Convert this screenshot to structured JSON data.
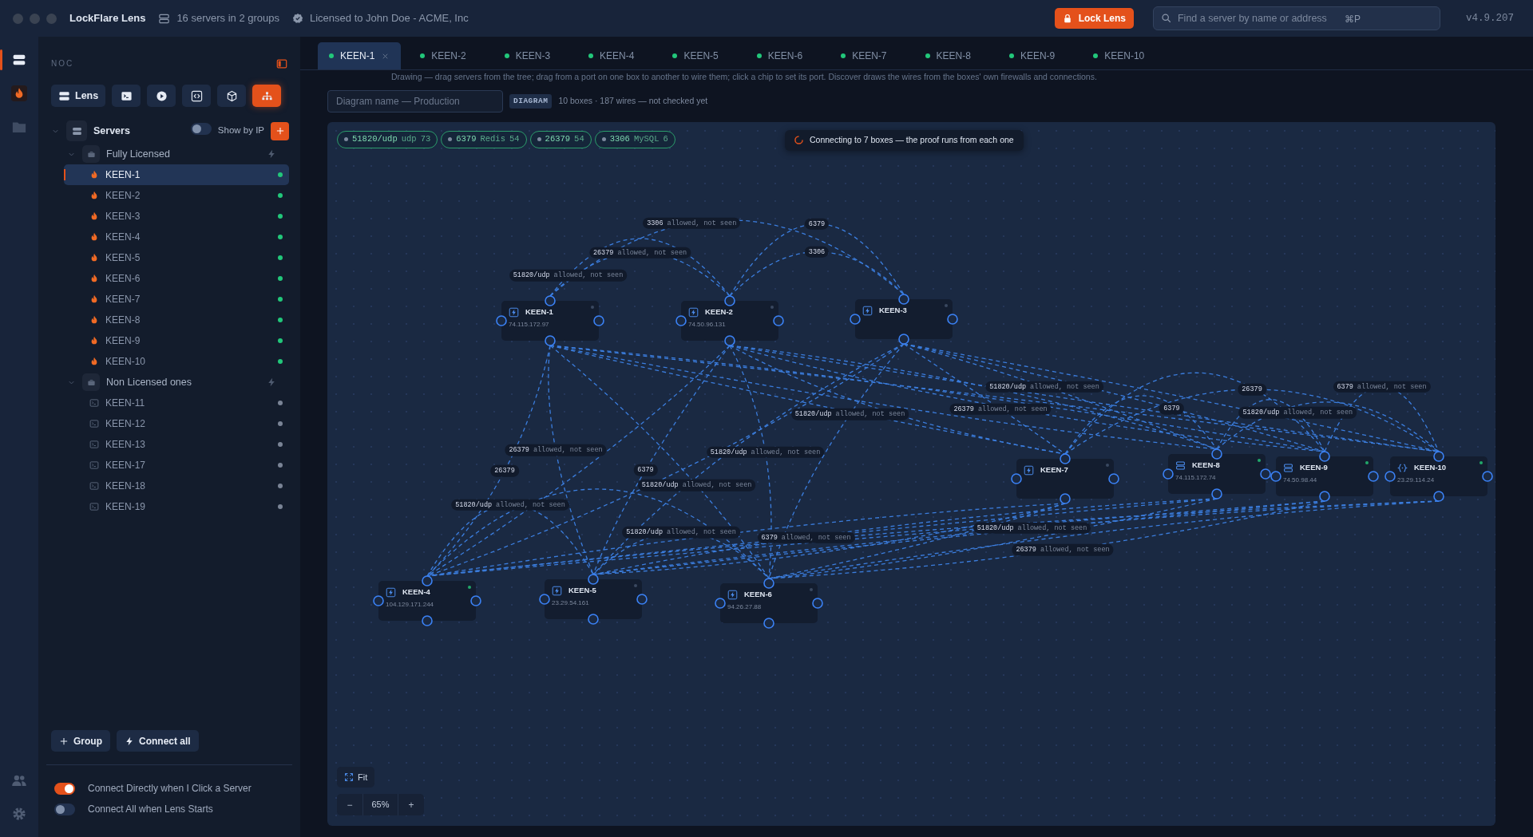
{
  "app": {
    "title": "LockFlare Lens",
    "server_summary": "16 servers in 2 groups",
    "license": "Licensed to John Doe - ACME, Inc",
    "lock_button": "Lock Lens",
    "search": {
      "placeholder": "Find a server by name or address",
      "shortcut": "⌘P"
    },
    "version": "v4.9.207"
  },
  "rail": {
    "top": [
      {
        "kind": "servers",
        "selected": true
      },
      {
        "kind": "app",
        "selected": false
      },
      {
        "kind": "folder",
        "selected": false
      }
    ],
    "bottom": [
      {
        "kind": "users",
        "selected": false
      },
      {
        "kind": "settings",
        "selected": false
      }
    ]
  },
  "sidebar": {
    "heading": "NOC",
    "tools": [
      {
        "kind": "servers",
        "label": "Lens",
        "selected": false
      },
      {
        "kind": "terminal",
        "selected": false
      },
      {
        "kind": "play",
        "selected": false
      },
      {
        "kind": "code",
        "selected": false
      },
      {
        "kind": "cube",
        "selected": false
      },
      {
        "kind": "sitemap",
        "selected": true
      }
    ],
    "tree": {
      "label": "Servers",
      "expanded": true,
      "show_by_ip": {
        "label": "Show by IP",
        "on": false
      },
      "groups": [
        {
          "label": "Fully Licensed",
          "expanded": true,
          "children": [
            {
              "label": "KEEN-1",
              "kind": "flame",
              "selected": true,
              "online": true
            },
            {
              "label": "KEEN-2",
              "kind": "flame",
              "selected": false,
              "online": true
            },
            {
              "label": "KEEN-3",
              "kind": "flame",
              "selected": false,
              "online": true
            },
            {
              "label": "KEEN-4",
              "kind": "flame",
              "selected": false,
              "online": true
            },
            {
              "label": "KEEN-5",
              "kind": "flame",
              "selected": false,
              "online": true
            },
            {
              "label": "KEEN-6",
              "kind": "flame",
              "selected": false,
              "online": true
            },
            {
              "label": "KEEN-7",
              "kind": "flame",
              "selected": false,
              "online": true
            },
            {
              "label": "KEEN-8",
              "kind": "flame",
              "selected": false,
              "online": true
            },
            {
              "label": "KEEN-9",
              "kind": "flame",
              "selected": false,
              "online": true
            },
            {
              "label": "KEEN-10",
              "kind": "flame",
              "selected": false,
              "online": true
            }
          ]
        },
        {
          "label": "Non Licensed ones",
          "expanded": true,
          "children": [
            {
              "label": "KEEN-11",
              "kind": "terminal",
              "selected": false,
              "online": false
            },
            {
              "label": "KEEN-12",
              "kind": "terminal",
              "selected": false,
              "online": false
            },
            {
              "label": "KEEN-13",
              "kind": "terminal",
              "selected": false,
              "online": false
            },
            {
              "label": "KEEN-17",
              "kind": "terminal",
              "selected": false,
              "online": false
            },
            {
              "label": "KEEN-18",
              "kind": "terminal",
              "selected": false,
              "online": false
            },
            {
              "label": "KEEN-19",
              "kind": "terminal",
              "selected": false,
              "online": false
            }
          ]
        }
      ]
    },
    "actions": [
      {
        "kind": "plus",
        "label": "Group"
      },
      {
        "kind": "bolt",
        "label": "Connect all"
      }
    ],
    "settings": [
      {
        "label": "Connect Directly when I Click a Server",
        "on": true
      },
      {
        "label": "Connect All when Lens Starts",
        "on": false
      }
    ]
  },
  "tabs": [
    {
      "label": "KEEN-1",
      "selected": true,
      "online": true
    },
    {
      "label": "KEEN-2",
      "selected": false,
      "online": true
    },
    {
      "label": "KEEN-3",
      "selected": false,
      "online": true
    },
    {
      "label": "KEEN-4",
      "selected": false,
      "online": true
    },
    {
      "label": "KEEN-5",
      "selected": false,
      "online": true
    },
    {
      "label": "KEEN-6",
      "selected": false,
      "online": true
    },
    {
      "label": "KEEN-7",
      "selected": false,
      "online": true
    },
    {
      "label": "KEEN-8",
      "selected": false,
      "online": true
    },
    {
      "label": "KEEN-9",
      "selected": false,
      "online": true
    },
    {
      "label": "KEEN-10",
      "selected": false,
      "online": true
    }
  ],
  "diagram": {
    "hint": "Drawing — drag servers from the tree; drag from a port on one box to another to wire them; click a chip to set its port. Discover draws the wires from the boxes' own firewalls and connections.",
    "name_field": {
      "placeholder": "Diagram name — Production"
    },
    "badge": "DIAGRAM",
    "summary": "10 boxes · 187 wires — not checked yet",
    "chips": [
      {
        "port": "51820/udp",
        "service": "udp",
        "count": "73"
      },
      {
        "port": "6379",
        "service": "Redis",
        "count": "54"
      },
      {
        "port": "26379",
        "count": "54"
      },
      {
        "port": "3306",
        "service": "MySQL",
        "count": "6"
      }
    ],
    "status": "Connecting to 7 boxes — the proof runs from each one",
    "nodes": [
      {
        "name": "KEEN-1",
        "address": "74.115.172.97",
        "kind": "bolt",
        "online": false
      },
      {
        "name": "KEEN-2",
        "address": "74.50.96.131",
        "kind": "bolt",
        "online": false
      },
      {
        "name": "KEEN-3",
        "kind": "bolt",
        "online": false
      },
      {
        "name": "KEEN-4",
        "address": "104.129.171.244",
        "kind": "bolt",
        "online": true
      },
      {
        "name": "KEEN-5",
        "address": "23.29.54.161",
        "kind": "bolt",
        "online": false
      },
      {
        "name": "KEEN-6",
        "address": "94.26.27.88",
        "kind": "bolt",
        "online": false
      },
      {
        "name": "KEEN-7",
        "kind": "bolt",
        "online": false
      },
      {
        "name": "KEEN-8",
        "address": "74.115.172.74",
        "kind": "server",
        "online": true
      },
      {
        "name": "KEEN-9",
        "address": "74.50.98.44",
        "kind": "server",
        "online": true
      },
      {
        "name": "KEEN-10",
        "address": "23.29.114.24",
        "kind": "braces",
        "online": true
      }
    ],
    "wire_labels": [
      {
        "port": "3306",
        "note": "allowed, not seen"
      },
      {
        "port": "6379"
      },
      {
        "port": "26379",
        "note": "allowed, not seen"
      },
      {
        "port": "3306"
      },
      {
        "port": "51820/udp",
        "note": "allowed, not seen"
      },
      {
        "port": "51820/udp",
        "note": "allowed, not seen"
      },
      {
        "port": "26379"
      },
      {
        "port": "6379",
        "note": "allowed, not seen"
      },
      {
        "port": "51820/udp",
        "note": "allowed, not seen"
      },
      {
        "port": "26379",
        "note": "allowed, not seen"
      },
      {
        "port": "6379"
      },
      {
        "port": "51820/udp",
        "note": "allowed, not seen"
      },
      {
        "port": "26379",
        "note": "allowed, not seen"
      },
      {
        "port": "51820/udp",
        "note": "allowed, not seen"
      },
      {
        "port": "26379"
      },
      {
        "port": "6379"
      },
      {
        "port": "51820/udp",
        "note": "allowed, not seen"
      },
      {
        "port": "51820/udp",
        "note": "allowed, not seen"
      },
      {
        "port": "51820/udp",
        "note": "allowed, not seen"
      },
      {
        "port": "6379",
        "note": "allowed, not seen"
      },
      {
        "port": "51820/udp",
        "note": "allowed, not seen"
      },
      {
        "port": "26379",
        "note": "allowed, not seen"
      }
    ],
    "zoom": {
      "fit": "Fit",
      "minus": "−",
      "level_text": "65%",
      "plus": "+"
    }
  }
}
